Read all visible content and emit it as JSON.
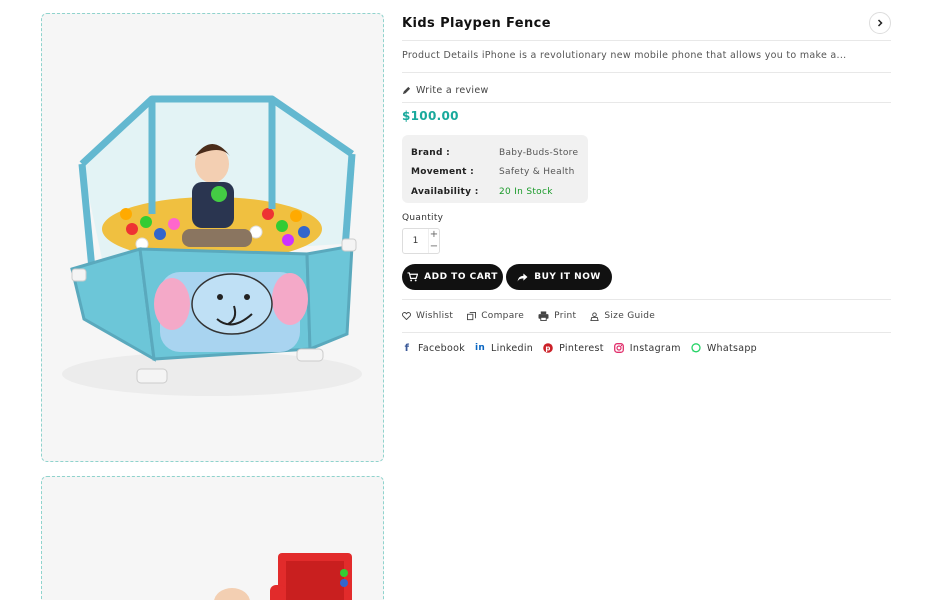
{
  "product": {
    "title": "Kids Playpen Fence",
    "description": "Product Details iPhone is a revolutionary new mobile phone that allows you to make a...",
    "review_link": "Write a review",
    "price": "$100.00"
  },
  "info": [
    {
      "label": "Brand :",
      "value": "Baby-Buds-Store"
    },
    {
      "label": "Movement :",
      "value": "Safety & Health"
    },
    {
      "label": "Availability :",
      "value": "20 In Stock"
    }
  ],
  "quantity": {
    "label": "Quantity",
    "value": "1",
    "plus": "+",
    "minus": "−"
  },
  "buttons": {
    "add_to_cart": "ADD TO CART",
    "buy_now": "BUY IT NOW"
  },
  "actions": [
    {
      "label": "Wishlist",
      "icon": "heart-icon"
    },
    {
      "label": "Compare",
      "icon": "compare-icon"
    },
    {
      "label": "Print",
      "icon": "print-icon"
    },
    {
      "label": "Size Guide",
      "icon": "size-guide-icon"
    }
  ],
  "social": [
    {
      "label": "Facebook",
      "icon": "facebook-icon",
      "color": "#3b5998"
    },
    {
      "label": "Linkedin",
      "icon": "linkedin-icon",
      "color": "#0a66c2"
    },
    {
      "label": "Pinterest",
      "icon": "pinterest-icon",
      "color": "#cb2027"
    },
    {
      "label": "Instagram",
      "icon": "instagram-icon",
      "color": "#e1306c"
    },
    {
      "label": "Whatsapp",
      "icon": "whatsapp-icon",
      "color": "#25d366"
    }
  ],
  "colors": {
    "accent": "#19a99c",
    "in_stock": "#1a9a2a",
    "frame_border": "#8fd3cd"
  }
}
